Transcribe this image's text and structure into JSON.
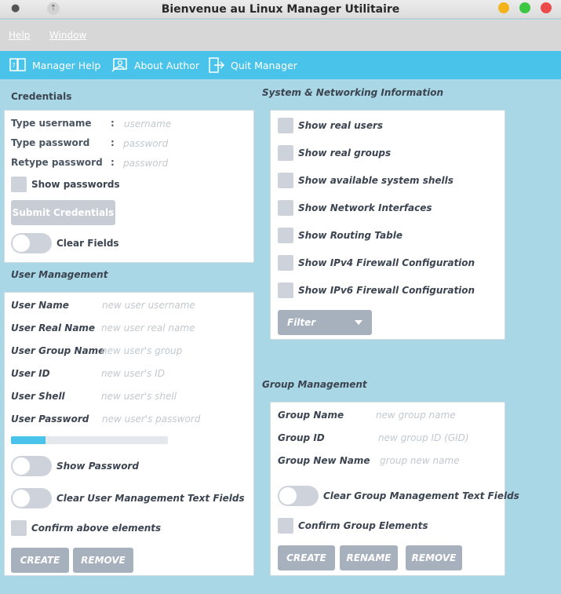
{
  "window": {
    "title": "Bienvenue au Linux Manager Utilitaire"
  },
  "menubar": {
    "help": "Help",
    "window": "Window"
  },
  "toolbar": {
    "manager_help": "Manager Help",
    "about_author": "About Author",
    "quit_manager": "Quit Manager"
  },
  "credentials": {
    "heading": "Credentials",
    "username_label": "Type username",
    "username_placeholder": "username",
    "password_label": "Type password",
    "password_placeholder": "password",
    "retype_label": "Retype password",
    "retype_placeholder": "password",
    "colon": ":",
    "show_passwords": "Show passwords",
    "submit": "Submit Credentials",
    "clear_fields": "Clear Fields"
  },
  "user_management": {
    "heading": "User Management",
    "fields": [
      {
        "label": "User Name",
        "placeholder": "new user username"
      },
      {
        "label": "User Real Name",
        "placeholder": "new user real name"
      },
      {
        "label": "User Group Name",
        "placeholder": "new user's group"
      },
      {
        "label": "User ID",
        "placeholder": "new user's ID"
      },
      {
        "label": "User Shell",
        "placeholder": "new user's shell"
      },
      {
        "label": "User Password",
        "placeholder": "new user's password"
      }
    ],
    "password_strength": 0.22,
    "show_password": "Show Password",
    "clear_fields": "Clear User Management Text Fields",
    "confirm": "Confirm above elements",
    "create": "CREATE",
    "remove": "REMOVE"
  },
  "system": {
    "heading": "System & Networking Information",
    "options": [
      "Show real users",
      "Show real groups",
      "Show available system shells",
      "Show Network Interfaces",
      "Show Routing Table",
      "Show IPv4 Firewall Configuration",
      "Show IPv6 Firewall Configuration"
    ],
    "filter": "Filter"
  },
  "group_management": {
    "heading": "Group Management",
    "fields": [
      {
        "label": "Group Name",
        "placeholder": "new group name"
      },
      {
        "label": "Group ID",
        "placeholder": "new group ID (GID)"
      },
      {
        "label": "Group New Name",
        "placeholder": "group new name"
      }
    ],
    "clear_fields": "Clear Group Management Text Fields",
    "confirm": "Confirm Group Elements",
    "create": "CREATE",
    "rename": "RENAME",
    "remove": "REMOVE"
  },
  "colors": {
    "background": "#a9d7e5",
    "toolbar": "#4ac3ea",
    "button": "#a7b0bd",
    "checkbox": "#ced3db"
  }
}
